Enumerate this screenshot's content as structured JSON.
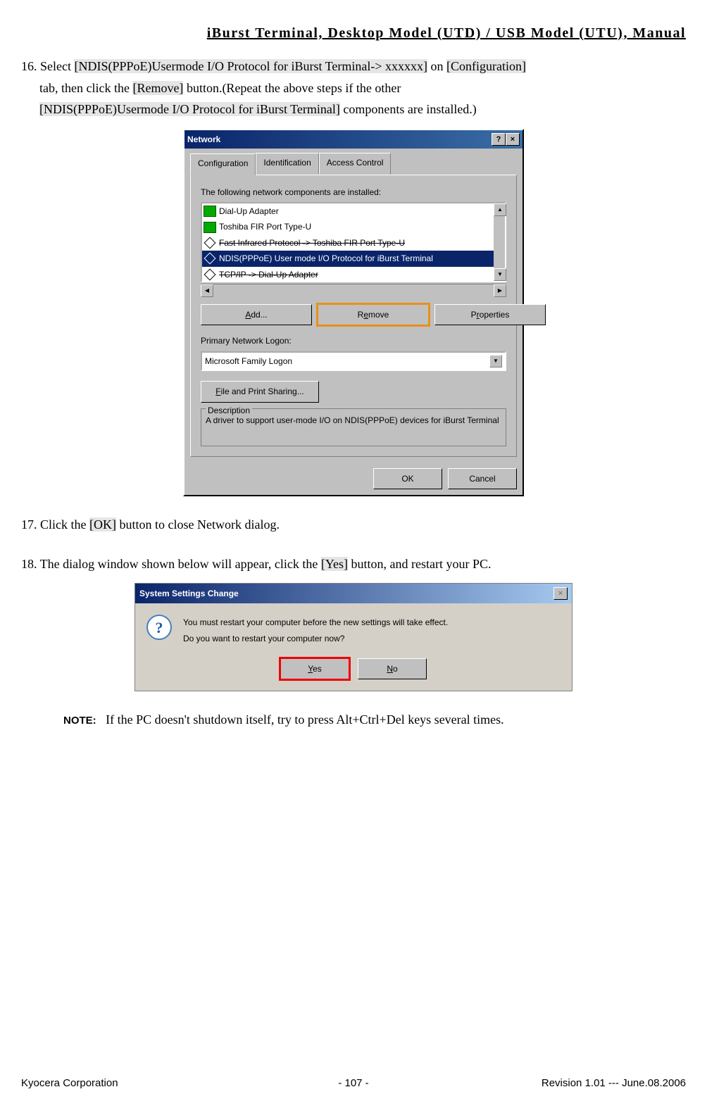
{
  "header": "iBurst Terminal, Desktop Model (UTD) / USB Model (UTU), Manual",
  "step16": {
    "prefix": "16. Select ",
    "hl1": "[NDIS(PPPoE)Usermode I/O Protocol for iBurst Terminal-> xxxxxx]",
    "mid1": " on ",
    "hl2": "[Configuration]",
    "line2_a": "tab, then click the ",
    "hl3": "[Remove]",
    "line2_b": " button.(Repeat the above steps if the other",
    "hl4": "[NDIS(PPPoE)Usermode I/O Protocol for iBurst Terminal]",
    "line3_b": " components are installed.)"
  },
  "network": {
    "title": "Network",
    "help_btn": "?",
    "close_btn": "×",
    "tabs": {
      "config": "Configuration",
      "ident": "Identification",
      "access": "Access Control"
    },
    "components_label": "The following network components are installed:",
    "items": {
      "dialup": "Dial-Up Adapter",
      "toshiba": "Toshiba FIR Port Type-U",
      "fast_ir": "Fast Infrared Protocol -> Toshiba FIR Port Type-U",
      "ndis": "NDIS(PPPoE) User mode I/O Protocol for iBurst Terminal ",
      "tcpip": "TCP/IP -> Dial-Up Adapter"
    },
    "buttons": {
      "add": "Add...",
      "remove": "Remove",
      "properties": "Properties"
    },
    "primary_label": "Primary Network Logon:",
    "primary_value": "Microsoft Family Logon",
    "file_print": "File and Print Sharing...",
    "desc_label": "Description",
    "desc_text": "A driver to support user-mode I/O on NDIS(PPPoE) devices for iBurst Terminal",
    "ok": "OK",
    "cancel": "Cancel"
  },
  "step17": {
    "a": "17. Click the ",
    "hl": "[OK]",
    "b": " button to close Network dialog."
  },
  "step18": {
    "a": "18. The dialog window shown below will appear, click the ",
    "hl": "[Yes]",
    "b": " button, and restart your PC."
  },
  "ssc": {
    "title": "System Settings Change",
    "close": "×",
    "line1": "You must restart your computer before the new settings will take effect.",
    "line2": "Do you want to restart your computer now?",
    "yes": "Yes",
    "no": "No"
  },
  "note": {
    "label": "NOTE:",
    "text": "If the PC doesn't shutdown itself, try to press Alt+Ctrl+Del keys several times."
  },
  "footer": {
    "left": "Kyocera Corporation",
    "center": "- 107 -",
    "right": "Revision 1.01 --- June.08.2006"
  }
}
